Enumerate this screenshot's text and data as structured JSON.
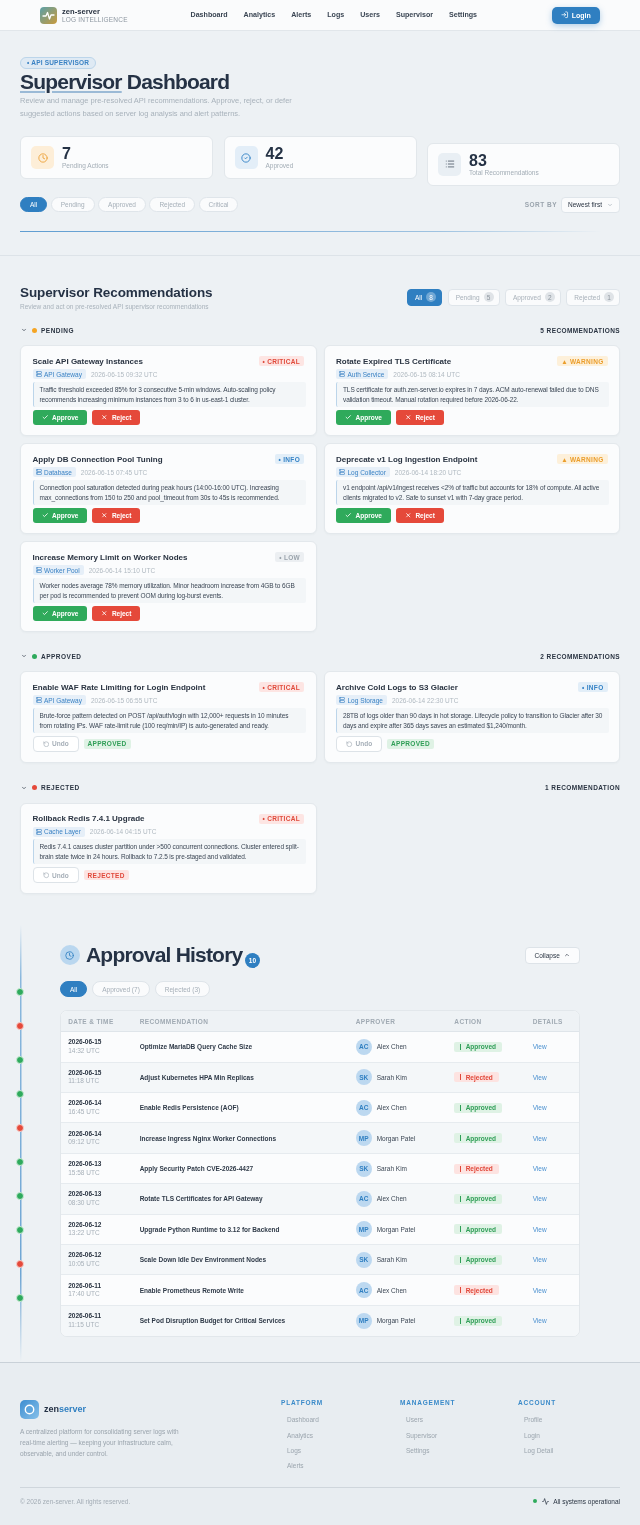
{
  "header": {
    "brand": {
      "name": "zen-server",
      "tagline": "LOG INTELLIGENCE"
    },
    "nav": [
      "Dashboard",
      "Analytics",
      "Alerts",
      "Logs",
      "Users",
      "Supervisor",
      "Settings"
    ],
    "login": "Login"
  },
  "hero": {
    "badge": "• API SUPERVISOR",
    "title": {
      "accent": "Supervisor",
      "rest": "Dashboard"
    },
    "subtitle": "Review and manage pre-resolved API recommendations. Approve, reject, or defer suggested actions based on server log analysis and alert patterns.",
    "stats": [
      {
        "kind": "pending",
        "value": "7",
        "label": "Pending Actions"
      },
      {
        "kind": "approved",
        "value": "42",
        "label": "Approved"
      },
      {
        "kind": "total",
        "value": "83",
        "label": "Total Recommendations"
      }
    ],
    "filters": [
      {
        "label": "All",
        "selected": true
      },
      {
        "label": "Pending",
        "selected": false
      },
      {
        "label": "Approved",
        "selected": false
      },
      {
        "label": "Rejected",
        "selected": false
      },
      {
        "label": "Critical",
        "selected": false
      }
    ],
    "sort": {
      "label": "SORT BY",
      "value": "Newest first"
    }
  },
  "recommendations": {
    "title": "Supervisor Recommendations",
    "subtitle": "Review and act on pre-resolved API supervisor recommendations",
    "tabs": [
      {
        "label": "All",
        "count": "8",
        "selected": true
      },
      {
        "label": "Pending",
        "count": "5",
        "selected": false
      },
      {
        "label": "Approved",
        "count": "2",
        "selected": false
      },
      {
        "label": "Rejected",
        "count": "1",
        "selected": false
      }
    ],
    "groups": [
      {
        "label": "PENDING",
        "color": "#f5a524",
        "count": "5 RECOMMENDATIONS",
        "expanded": true,
        "cards": [
          {
            "kind": "pending",
            "title": "Scale API Gateway Instances",
            "severity": {
              "label": "• CRITICAL",
              "kind": "critical"
            },
            "service": "API Gateway",
            "time": "2026-06-15 09:32 UTC",
            "description": "Traffic threshold exceeded 85% for 3 consecutive 5-min windows. Auto-scaling policy recommends increasing minimum instances from 3 to 6 in us-east-1 cluster.",
            "approve": "Approve",
            "reject": "Reject"
          },
          {
            "kind": "pending",
            "title": "Rotate Expired TLS Certificate",
            "severity": {
              "label": "▲ WARNING",
              "kind": "warning"
            },
            "service": "Auth Service",
            "time": "2026-06-15 08:14 UTC",
            "description": "TLS certificate for auth.zen-server.io expires in 7 days. ACM auto-renewal failed due to DNS validation timeout. Manual rotation required before 2026-06-22.",
            "approve": "Approve",
            "reject": "Reject"
          },
          {
            "kind": "pending",
            "title": "Apply DB Connection Pool Tuning",
            "severity": {
              "label": "• INFO",
              "kind": "info"
            },
            "service": "Database",
            "time": "2026-06-15 07:45 UTC",
            "description": "Connection pool saturation detected during peak hours (14:00-16:00 UTC). Increasing max_connections from 150 to 250 and pool_timeout from 30s to 45s is recommended.",
            "approve": "Approve",
            "reject": "Reject"
          },
          {
            "kind": "pending",
            "title": "Deprecate v1 Log Ingestion Endpoint",
            "severity": {
              "label": "▲ WARNING",
              "kind": "warning"
            },
            "service": "Log Collector",
            "time": "2026-06-14 18:20 UTC",
            "description": "v1 endpoint /api/v1/ingest receives <2% of traffic but accounts for 18% of compute. All active clients migrated to v2. Safe to sunset v1 with 7-day grace period.",
            "approve": "Approve",
            "reject": "Reject"
          },
          {
            "kind": "pending",
            "title": "Increase Memory Limit on Worker Nodes",
            "severity": {
              "label": "• LOW",
              "kind": "low"
            },
            "service": "Worker Pool",
            "time": "2026-06-14 15:10 UTC",
            "description": "Worker nodes average 78% memory utilization. Minor headroom increase from 4GB to 6GB per pod is recommended to prevent OOM during log-burst events.",
            "approve": "Approve",
            "reject": "Reject"
          }
        ]
      },
      {
        "label": "APPROVED",
        "color": "#2eaa5c",
        "count": "2 RECOMMENDATIONS",
        "expanded": true,
        "cards": [
          {
            "kind": "decided",
            "title": "Enable WAF Rate Limiting for Login Endpoint",
            "severity": {
              "label": "• CRITICAL",
              "kind": "critical"
            },
            "service": "API Gateway",
            "time": "2026-06-15 06:55 UTC",
            "description": "Brute-force pattern detected on POST /api/auth/login with 12,000+ requests in 10 minutes from rotating IPs. WAF rate-limit rule (100 req/min/IP) is auto-generated and ready.",
            "undo": "Undo",
            "status": {
              "label": "APPROVED",
              "kind": "approved"
            }
          },
          {
            "kind": "decided",
            "title": "Archive Cold Logs to S3 Glacier",
            "severity": {
              "label": "• INFO",
              "kind": "info"
            },
            "service": "Log Storage",
            "time": "2026-06-14 22:30 UTC",
            "description": "28TB of logs older than 90 days in hot storage. Lifecycle policy to transition to Glacier after 30 days and expire after 365 days saves an estimated $1,240/month.",
            "undo": "Undo",
            "status": {
              "label": "APPROVED",
              "kind": "approved"
            }
          }
        ]
      },
      {
        "label": "REJECTED",
        "color": "#e5493a",
        "count": "1 RECOMMENDATION",
        "expanded": true,
        "cards": [
          {
            "kind": "decided",
            "title": "Rollback Redis 7.4.1 Upgrade",
            "severity": {
              "label": "• CRITICAL",
              "kind": "critical"
            },
            "service": "Cache Layer",
            "time": "2026-06-14 04:15 UTC",
            "description": "Redis 7.4.1 causes cluster partition under >500 concurrent connections. Cluster entered split-brain state twice in 24 hours. Rollback to 7.2.5 is pre-staged and validated.",
            "undo": "Undo",
            "status": {
              "label": "REJECTED",
              "kind": "rejected"
            }
          }
        ]
      }
    ]
  },
  "history": {
    "title": "Approval History",
    "count": "10",
    "collapse": "Collapse",
    "filters": [
      {
        "label": "All",
        "selected": true
      },
      {
        "label": "Approved (7)",
        "selected": false
      },
      {
        "label": "Rejected (3)",
        "selected": false
      }
    ],
    "columns": [
      "DATE & TIME",
      "RECOMMENDATION",
      "APPROVER",
      "ACTION",
      "DETAILS"
    ],
    "rows": [
      {
        "date": "2026-06-15",
        "time": "14:32 UTC",
        "recommendation": "Optimize MariaDB Query Cache Size",
        "initials": "AC",
        "approver": "Alex Chen",
        "action": {
          "label": "Approved",
          "kind": "approved"
        },
        "details": "View"
      },
      {
        "date": "2026-06-15",
        "time": "11:18 UTC",
        "recommendation": "Adjust Kubernetes HPA Min Replicas",
        "initials": "SK",
        "approver": "Sarah Kim",
        "action": {
          "label": "Rejected",
          "kind": "rejected"
        },
        "details": "View"
      },
      {
        "date": "2026-06-14",
        "time": "16:45 UTC",
        "recommendation": "Enable Redis Persistence (AOF)",
        "initials": "AC",
        "approver": "Alex Chen",
        "action": {
          "label": "Approved",
          "kind": "approved"
        },
        "details": "View"
      },
      {
        "date": "2026-06-14",
        "time": "09:12 UTC",
        "recommendation": "Increase Ingress Nginx Worker Connections",
        "initials": "MP",
        "approver": "Morgan Patel",
        "action": {
          "label": "Approved",
          "kind": "approved"
        },
        "details": "View"
      },
      {
        "date": "2026-06-13",
        "time": "15:58 UTC",
        "recommendation": "Apply Security Patch CVE-2026-4427",
        "initials": "SK",
        "approver": "Sarah Kim",
        "action": {
          "label": "Rejected",
          "kind": "rejected"
        },
        "details": "View"
      },
      {
        "date": "2026-06-13",
        "time": "08:30 UTC",
        "recommendation": "Rotate TLS Certificates for API Gateway",
        "initials": "AC",
        "approver": "Alex Chen",
        "action": {
          "label": "Approved",
          "kind": "approved"
        },
        "details": "View"
      },
      {
        "date": "2026-06-12",
        "time": "13:22 UTC",
        "recommendation": "Upgrade Python Runtime to 3.12 for Backend",
        "initials": "MP",
        "approver": "Morgan Patel",
        "action": {
          "label": "Approved",
          "kind": "approved"
        },
        "details": "View"
      },
      {
        "date": "2026-06-12",
        "time": "10:05 UTC",
        "recommendation": "Scale Down Idle Dev Environment Nodes",
        "initials": "SK",
        "approver": "Sarah Kim",
        "action": {
          "label": "Approved",
          "kind": "approved"
        },
        "details": "View"
      },
      {
        "date": "2026-06-11",
        "time": "17:40 UTC",
        "recommendation": "Enable Prometheus Remote Write",
        "initials": "AC",
        "approver": "Alex Chen",
        "action": {
          "label": "Rejected",
          "kind": "rejected"
        },
        "details": "View"
      },
      {
        "date": "2026-06-11",
        "time": "11:15 UTC",
        "recommendation": "Set Pod Disruption Budget for Critical Services",
        "initials": "MP",
        "approver": "Morgan Patel",
        "action": {
          "label": "Approved",
          "kind": "approved"
        },
        "details": "View"
      }
    ]
  },
  "footer": {
    "brand": {
      "lead": "zen",
      "accent": "server"
    },
    "description": "A centralized platform for consolidating server logs with real-time alerting — keeping your infrastructure calm, observable, and under control.",
    "columns": [
      {
        "heading": "PLATFORM",
        "links": [
          "Dashboard",
          "Analytics",
          "Logs",
          "Alerts"
        ]
      },
      {
        "heading": "MANAGEMENT",
        "links": [
          "Users",
          "Supervisor",
          "Settings"
        ]
      },
      {
        "heading": "ACCOUNT",
        "links": [
          "Profile",
          "Login",
          "Log Detail"
        ]
      }
    ],
    "copyright": "© 2026 zen-server. All rights reserved.",
    "status": "All systems operational"
  }
}
